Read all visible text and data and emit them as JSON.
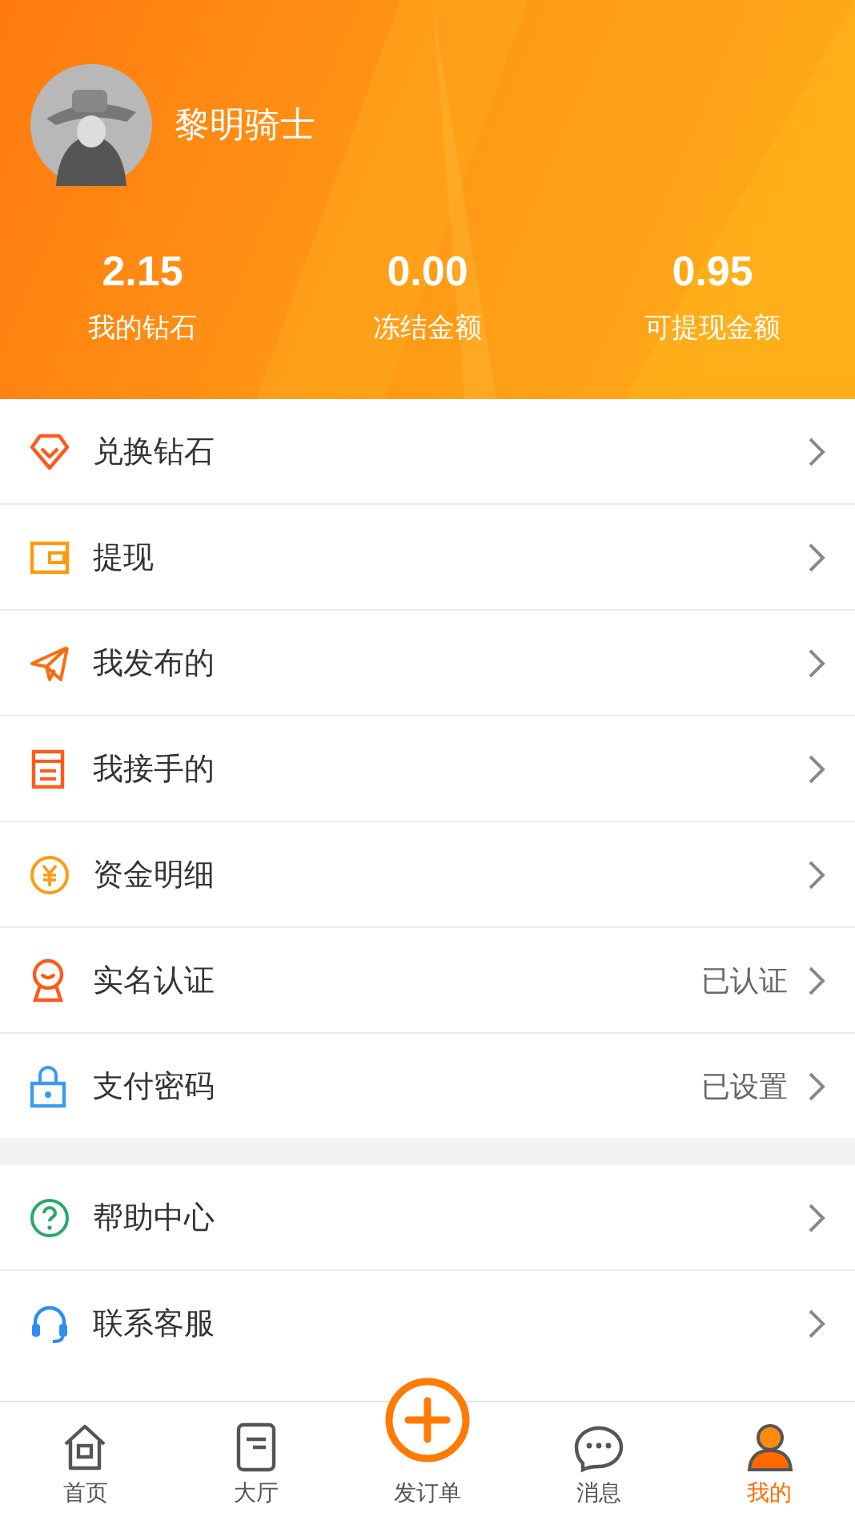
{
  "profile": {
    "name": "黎明骑士"
  },
  "stats": [
    {
      "value": "2.15",
      "label": "我的钻石"
    },
    {
      "value": "0.00",
      "label": "冻结金额"
    },
    {
      "value": "0.95",
      "label": "可提现金额"
    }
  ],
  "menu_groups": [
    [
      {
        "label": "兑换钻石"
      },
      {
        "label": "提现"
      },
      {
        "label": "我发布的"
      },
      {
        "label": "我接手的"
      },
      {
        "label": "资金明细"
      },
      {
        "label": "实名认证",
        "value": "已认证"
      },
      {
        "label": "支付密码",
        "value": "已设置"
      }
    ],
    [
      {
        "label": "帮助中心"
      },
      {
        "label": "联系客服"
      }
    ]
  ],
  "tabs": [
    {
      "label": "首页",
      "selected": false
    },
    {
      "label": "大厅",
      "selected": false
    },
    {
      "label": "发订单",
      "selected": false
    },
    {
      "label": "消息",
      "selected": false
    },
    {
      "label": "我的",
      "selected": true
    }
  ]
}
